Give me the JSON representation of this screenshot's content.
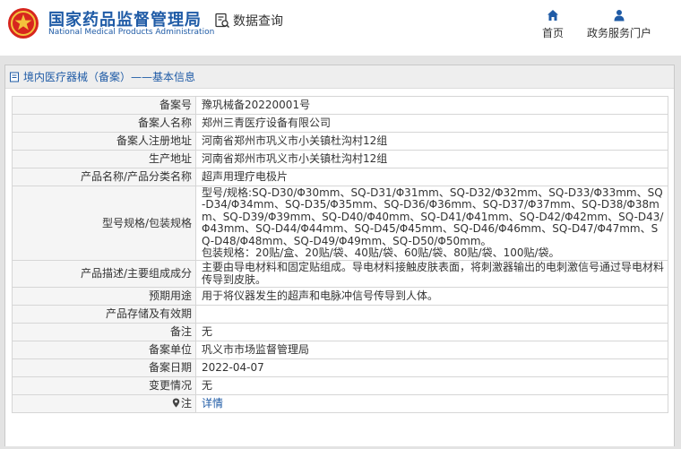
{
  "header": {
    "title_cn": "国家药品监督管理局",
    "title_en": "National Medical Products Administration",
    "query_label": "数据查询",
    "nav": [
      {
        "label": "首页",
        "icon": "home-icon"
      },
      {
        "label": "政务服务门户",
        "icon": "user-icon"
      }
    ],
    "brand_color": "#1f5ba6"
  },
  "breadcrumb": {
    "text": "境内医疗器械（备案）——基本信息"
  },
  "record": {
    "rows": [
      {
        "label": "备案号",
        "value": "豫巩械备20220001号"
      },
      {
        "label": "备案人名称",
        "value": "郑州三青医疗设备有限公司"
      },
      {
        "label": "备案人注册地址",
        "value": "河南省郑州市巩义市小关镇杜沟村12组"
      },
      {
        "label": "生产地址",
        "value": "河南省郑州市巩义市小关镇杜沟村12组"
      },
      {
        "label": "产品名称/产品分类名称",
        "value": "超声用理疗电极片"
      },
      {
        "label": "型号规格/包装规格",
        "value": "型号/规格:SQ-D30/Φ30mm、SQ-D31/Φ31mm、SQ-D32/Φ32mm、SQ-D33/Φ33mm、SQ-D34/Φ34mm、SQ-D35/Φ35mm、SQ-D36/Φ36mm、SQ-D37/Φ37mm、SQ-D38/Φ38mm、SQ-D39/Φ39mm、SQ-D40/Φ40mm、SQ-D41/Φ41mm、SQ-D42/Φ42mm、SQ-D43/Φ43mm、SQ-D44/Φ44mm、SQ-D45/Φ45mm、SQ-D46/Φ46mm、SQ-D47/Φ47mm、SQ-D48/Φ48mm、SQ-D49/Φ49mm、SQ-D50/Φ50mm。",
        "value2": "包装规格：20贴/盒、20贴/袋、40贴/袋、60贴/袋、80贴/袋、100贴/袋。"
      },
      {
        "label": "产品描述/主要组成成分",
        "value": "主要由导电材料和固定贴组成。导电材料接触皮肤表面，将刺激器输出的电刺激信号通过导电材料传导到皮肤。"
      },
      {
        "label": "预期用途",
        "value": "用于将仪器发生的超声和电脉冲信号传导到人体。"
      },
      {
        "label": "产品存储及有效期",
        "value": ""
      },
      {
        "label": "备注",
        "value": "无"
      },
      {
        "label": "备案单位",
        "value": "巩义市市场监督管理局"
      },
      {
        "label": "备案日期",
        "value": "2022-04-07"
      },
      {
        "label": "变更情况",
        "value": "无"
      },
      {
        "label": "注",
        "value": "详情"
      }
    ]
  }
}
